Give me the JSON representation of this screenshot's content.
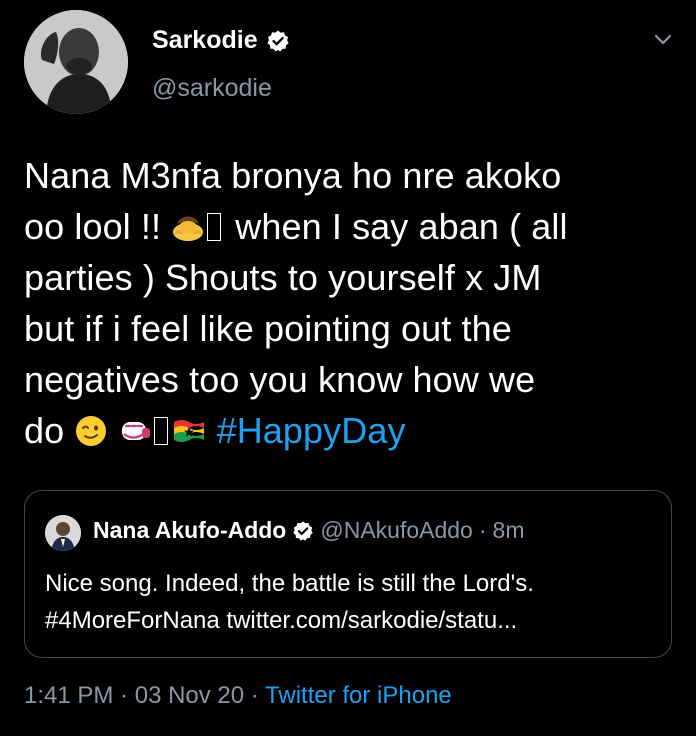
{
  "tweet": {
    "author": {
      "display_name": "Sarkodie",
      "handle": "@sarkodie",
      "verified_icon": "verified-badge-icon",
      "avatar_icon": "profile-photo"
    },
    "menu_icon": "chevron-down-icon",
    "body_lines": {
      "l1": "Nana M3nfa bronya ho nre akoko",
      "l2_a": "oo lool !! ",
      "l2_emoji": "bowing-person-emoji",
      "l2_b": " when I say aban ( all",
      "l3": "parties ) Shouts to yourself x JM",
      "l4": "but if i feel like pointing out the",
      "l5": "negatives too you know how we",
      "l6_a": "do ",
      "l6_emoji1": "winking-face-emoji",
      "l6_emoji2": "oncoming-fist-emoji",
      "l6_emoji3": "ghana-flag-emoji",
      "hashtag": "#HappyDay"
    },
    "quoted": {
      "display_name": "Nana Akufo-Addo",
      "handle": "@NAkufoAddo",
      "separator": "·",
      "time": "8m",
      "line1": "Nice song. Indeed, the battle is still the Lord's.",
      "line2": "#4MoreForNana twitter.com/sarkodie/statu..."
    },
    "meta": {
      "time": "1:41 PM",
      "sep1": " · ",
      "date": "03 Nov 20",
      "sep2": " · ",
      "source": "Twitter for iPhone"
    },
    "colors": {
      "background": "#000000",
      "text": "#ffffff",
      "secondary": "#8899a6",
      "link": "#1da1f2",
      "border": "#3d4a55"
    }
  }
}
